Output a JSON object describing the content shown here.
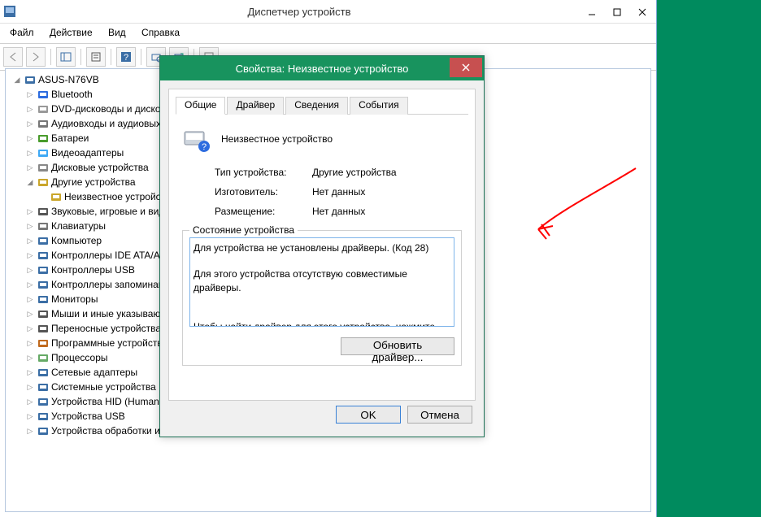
{
  "dm": {
    "title": "Диспетчер устройств",
    "menu": [
      "Файл",
      "Действие",
      "Вид",
      "Справка"
    ],
    "root": "ASUS-N76VB",
    "nodes": [
      {
        "icon": "bt",
        "label": "Bluetooth"
      },
      {
        "icon": "dvd",
        "label": "DVD-дисководы и дисководы компакт-дисков"
      },
      {
        "icon": "snd",
        "label": "Аудиовходы и аудиовыходы"
      },
      {
        "icon": "bat",
        "label": "Батареи"
      },
      {
        "icon": "vid",
        "label": "Видеоадаптеры"
      },
      {
        "icon": "disk",
        "label": "Дисковые устройства"
      },
      {
        "icon": "unk",
        "label": "Другие устройства",
        "expanded": true,
        "children": [
          {
            "icon": "unk",
            "label": "Неизвестное устройство"
          }
        ]
      },
      {
        "icon": "spk",
        "label": "Звуковые, игровые и видеоустройства"
      },
      {
        "icon": "kb",
        "label": "Клавиатуры"
      },
      {
        "icon": "pc",
        "label": "Компьютер"
      },
      {
        "icon": "ide",
        "label": "Контроллеры IDE ATA/ATAPI"
      },
      {
        "icon": "usb",
        "label": "Контроллеры USB"
      },
      {
        "icon": "mem",
        "label": "Контроллеры запоминающих устройств"
      },
      {
        "icon": "mon",
        "label": "Мониторы"
      },
      {
        "icon": "mse",
        "label": "Мыши и иные указывающие устройства"
      },
      {
        "icon": "port",
        "label": "Переносные устройства"
      },
      {
        "icon": "sw",
        "label": "Программные устройства"
      },
      {
        "icon": "cpu",
        "label": "Процессоры"
      },
      {
        "icon": "net",
        "label": "Сетевые адаптеры"
      },
      {
        "icon": "sys",
        "label": "Системные устройства"
      },
      {
        "icon": "hid",
        "label": "Устройства HID (Human Interface Devices)"
      },
      {
        "icon": "usb",
        "label": "Устройства USB"
      },
      {
        "icon": "img",
        "label": "Устройства обработки изображений"
      }
    ]
  },
  "prop": {
    "title": "Свойства: Неизвестное устройство",
    "tabs": [
      "Общие",
      "Драйвер",
      "Сведения",
      "События"
    ],
    "active_tab": 0,
    "device_name": "Неизвестное устройство",
    "type_label": "Тип устройства:",
    "type_value": "Другие устройства",
    "mfr_label": "Изготовитель:",
    "mfr_value": "Нет данных",
    "loc_label": "Размещение:",
    "loc_value": "Нет данных",
    "status_title": "Состояние устройства",
    "status_text": "Для устройства не установлены драйверы. (Код 28)\n\nДля этого устройства отсутствую совместимые драйверы.\n\n\nЧтобы найти драйвер для этого устройства, нажмите кнопку \"Обновить драйвер\".",
    "update_btn": "Обновить драйвер...",
    "ok": "OK",
    "cancel": "Отмена"
  }
}
